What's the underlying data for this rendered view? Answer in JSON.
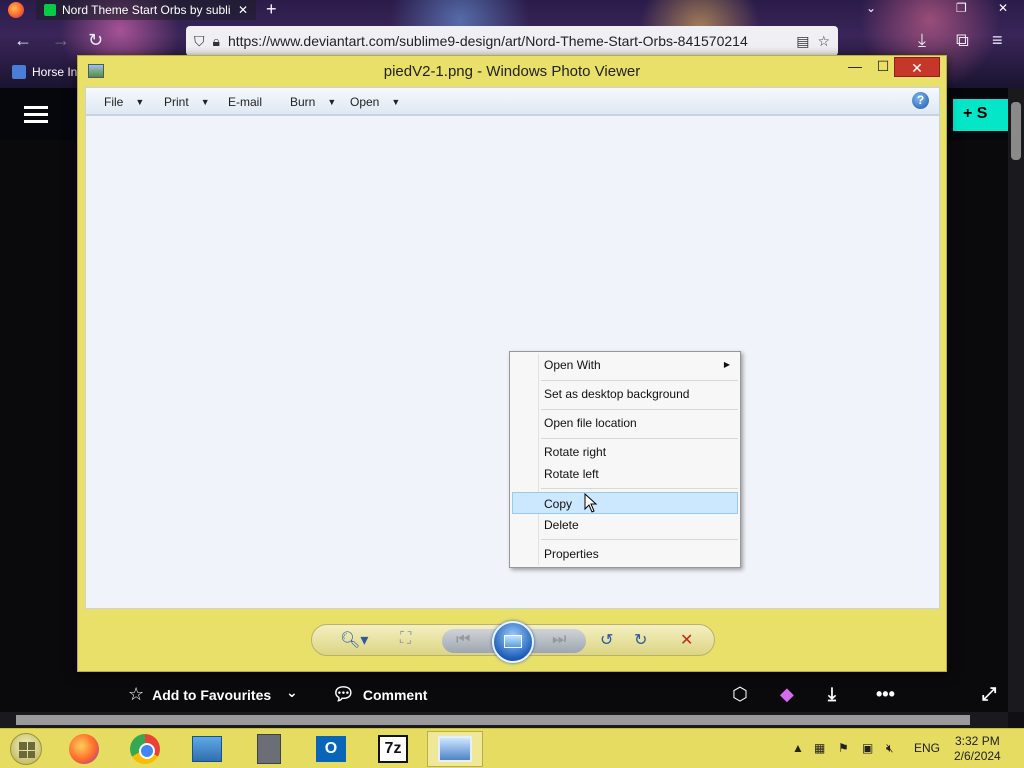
{
  "browser": {
    "tab_title": "Nord Theme Start Orbs by subli",
    "tab_close": "✕",
    "new_tab": "+",
    "url": "https://www.deviantart.com/sublime9-design/art/Nord-Theme-Start-Orbs-841570214",
    "bookmark": "Horse In",
    "nav_icons": [
      "back-icon",
      "forward-icon",
      "reload-icon"
    ],
    "right_icons": [
      "download-icon",
      "extensions-icon",
      "menu-icon"
    ]
  },
  "page": {
    "submit_label": "+ S",
    "actions": {
      "add_favourites": "Add to Favourites",
      "comment": "Comment"
    }
  },
  "photo_viewer": {
    "title": "piedV2-1.png - Windows Photo Viewer",
    "min": "—",
    "max": "☐",
    "close": "✕",
    "menu": [
      {
        "label": "File",
        "has_dropdown": true
      },
      {
        "label": "Print",
        "has_dropdown": true
      },
      {
        "label": "E-mail",
        "has_dropdown": false
      },
      {
        "label": "Burn",
        "has_dropdown": true
      },
      {
        "label": "Open",
        "has_dropdown": true
      }
    ],
    "help": "?",
    "controls": [
      "zoom-icon",
      "actual-size-icon",
      "previous-icon",
      "slideshow-icon",
      "next-icon",
      "rotate-counterclockwise-icon",
      "rotate-clockwise-icon",
      "delete-icon"
    ]
  },
  "context_menu": {
    "items": [
      {
        "label": "Open With",
        "submenu": true
      },
      {
        "label": "Set as desktop background"
      },
      {
        "label": "Open file location"
      },
      {
        "label": "Rotate right"
      },
      {
        "label": "Rotate left"
      },
      {
        "label": "Copy",
        "highlighted": true
      },
      {
        "label": "Delete"
      },
      {
        "label": "Properties"
      }
    ]
  },
  "taskbar": {
    "apps": [
      "firefox-icon",
      "chrome-icon",
      "control-panel-icon",
      "document-icon",
      "outlook-icon",
      "7zip-icon",
      "photo-viewer-icon"
    ],
    "outlook_label": "O",
    "sevenzip_label": "7z",
    "language": "ENG",
    "time": "3:32 PM",
    "date": "2/6/2024"
  },
  "colors": {
    "window_frame": "#e9e06a",
    "taskbar": "#e6dc61",
    "close_button": "#c7362b",
    "highlight": "#cce8ff",
    "da_accent": "#05e5c8"
  }
}
